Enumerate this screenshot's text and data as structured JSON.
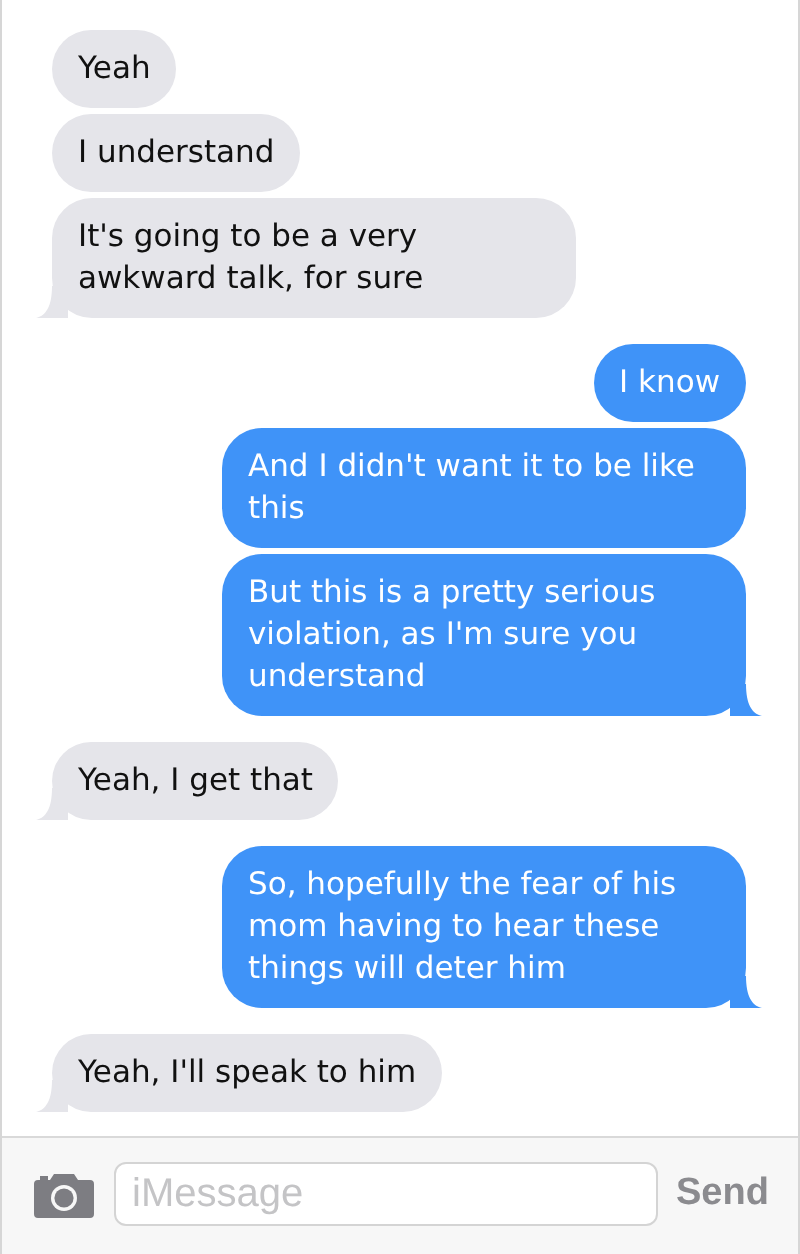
{
  "messages": [
    {
      "kind": "received",
      "text": "Yeah",
      "tail": false
    },
    {
      "kind": "received",
      "text": "I understand",
      "tail": false
    },
    {
      "kind": "received",
      "text": "It's going to be a very awkward talk, for sure",
      "tail": true
    },
    {
      "kind": "sent",
      "text": "I know",
      "tail": false
    },
    {
      "kind": "sent",
      "text": "And I didn't want it to be like this",
      "tail": false
    },
    {
      "kind": "sent",
      "text": "But this is a pretty serious violation, as I'm sure you understand",
      "tail": true
    },
    {
      "kind": "received",
      "text": "Yeah, I get that",
      "tail": true
    },
    {
      "kind": "sent",
      "text": "So, hopefully the fear of his mom having to hear these things will deter him",
      "tail": true
    },
    {
      "kind": "received",
      "text": "Yeah, I'll speak to him",
      "tail": true
    }
  ],
  "composer": {
    "placeholder": "iMessage",
    "send": "Send"
  }
}
